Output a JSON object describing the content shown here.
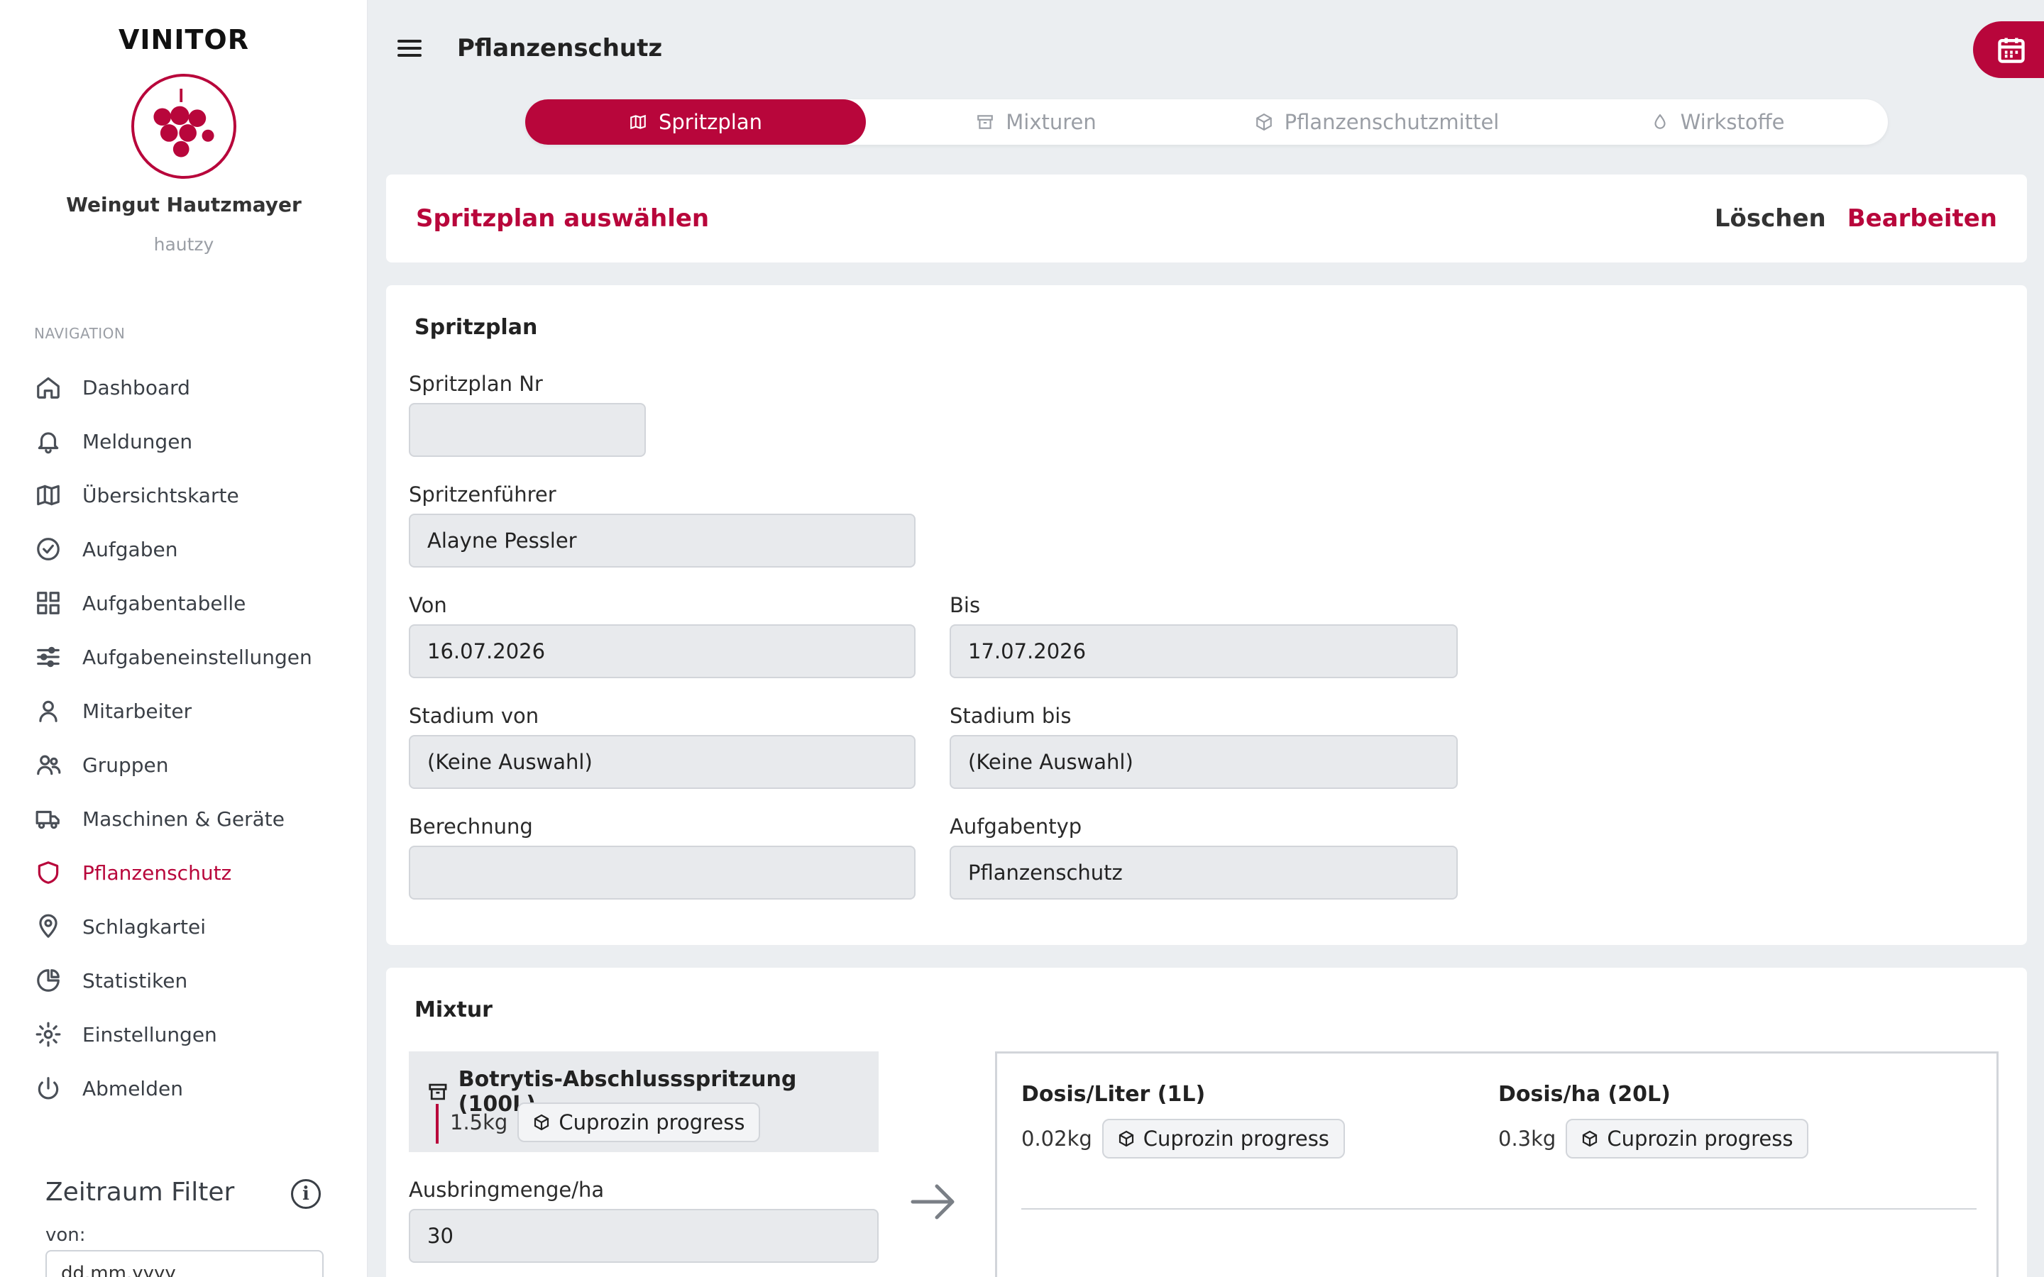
{
  "app": {
    "brand": "VINITOR",
    "org_name": "Weingut Hautzmayer",
    "org_user": "hautzy",
    "accent": "#b8063b"
  },
  "sidebar": {
    "heading": "NAVIGATION",
    "items": [
      {
        "label": "Dashboard",
        "icon": "home-icon"
      },
      {
        "label": "Meldungen",
        "icon": "bell-icon"
      },
      {
        "label": "Übersichtskarte",
        "icon": "map-icon"
      },
      {
        "label": "Aufgaben",
        "icon": "check-circle-icon"
      },
      {
        "label": "Aufgabentabelle",
        "icon": "grid-icon"
      },
      {
        "label": "Aufgabeneinstellungen",
        "icon": "sliders-icon"
      },
      {
        "label": "Mitarbeiter",
        "icon": "user-icon"
      },
      {
        "label": "Gruppen",
        "icon": "users-icon"
      },
      {
        "label": "Maschinen & Geräte",
        "icon": "truck-icon"
      },
      {
        "label": "Pflanzenschutz",
        "icon": "shield-icon",
        "active": true
      },
      {
        "label": "Schlagkartei",
        "icon": "map-pin-icon"
      },
      {
        "label": "Statistiken",
        "icon": "pie-chart-icon"
      },
      {
        "label": "Einstellungen",
        "icon": "gear-icon"
      },
      {
        "label": "Abmelden",
        "icon": "power-icon"
      }
    ],
    "filter": {
      "title": "Zeitraum Filter",
      "info": "i",
      "von_label": "von:",
      "von_placeholder": "dd.mm.yyyy"
    }
  },
  "header": {
    "title": "Pflanzenschutz"
  },
  "tabs": [
    {
      "label": "Spritzplan",
      "active": true
    },
    {
      "label": "Mixturen"
    },
    {
      "label": "Pflanzenschutzmittel"
    },
    {
      "label": "Wirkstoffe"
    }
  ],
  "selector": {
    "title": "Spritzplan auswählen",
    "delete_label": "Löschen",
    "edit_label": "Bearbeiten"
  },
  "plan": {
    "section_title": "Spritzplan",
    "nr_label": "Spritzplan Nr",
    "nr_value": "",
    "driver_label": "Spritzenführer",
    "driver_value": "Alayne Pessler",
    "von_label": "Von",
    "von_value": "16.07.2026",
    "bis_label": "Bis",
    "bis_value": "17.07.2026",
    "stadium_von_label": "Stadium von",
    "stadium_von_value": "(Keine Auswahl)",
    "stadium_bis_label": "Stadium bis",
    "stadium_bis_value": "(Keine Auswahl)",
    "berechnung_label": "Berechnung",
    "berechnung_value": "",
    "aufgabentyp_label": "Aufgabentyp",
    "aufgabentyp_value": "Pflanzenschutz"
  },
  "mixture": {
    "section_title": "Mixtur",
    "name": "Botrytis-Abschlussspritzung (100L)",
    "qty": "1.5kg",
    "product": "Cuprozin progress",
    "amount_label": "Ausbringmenge/ha",
    "amount_value": "30",
    "dose_liter_title": "Dosis/Liter (1L)",
    "dose_liter_qty": "0.02kg",
    "dose_ha_title": "Dosis/ha (20L)",
    "dose_ha_qty": "0.3kg"
  }
}
